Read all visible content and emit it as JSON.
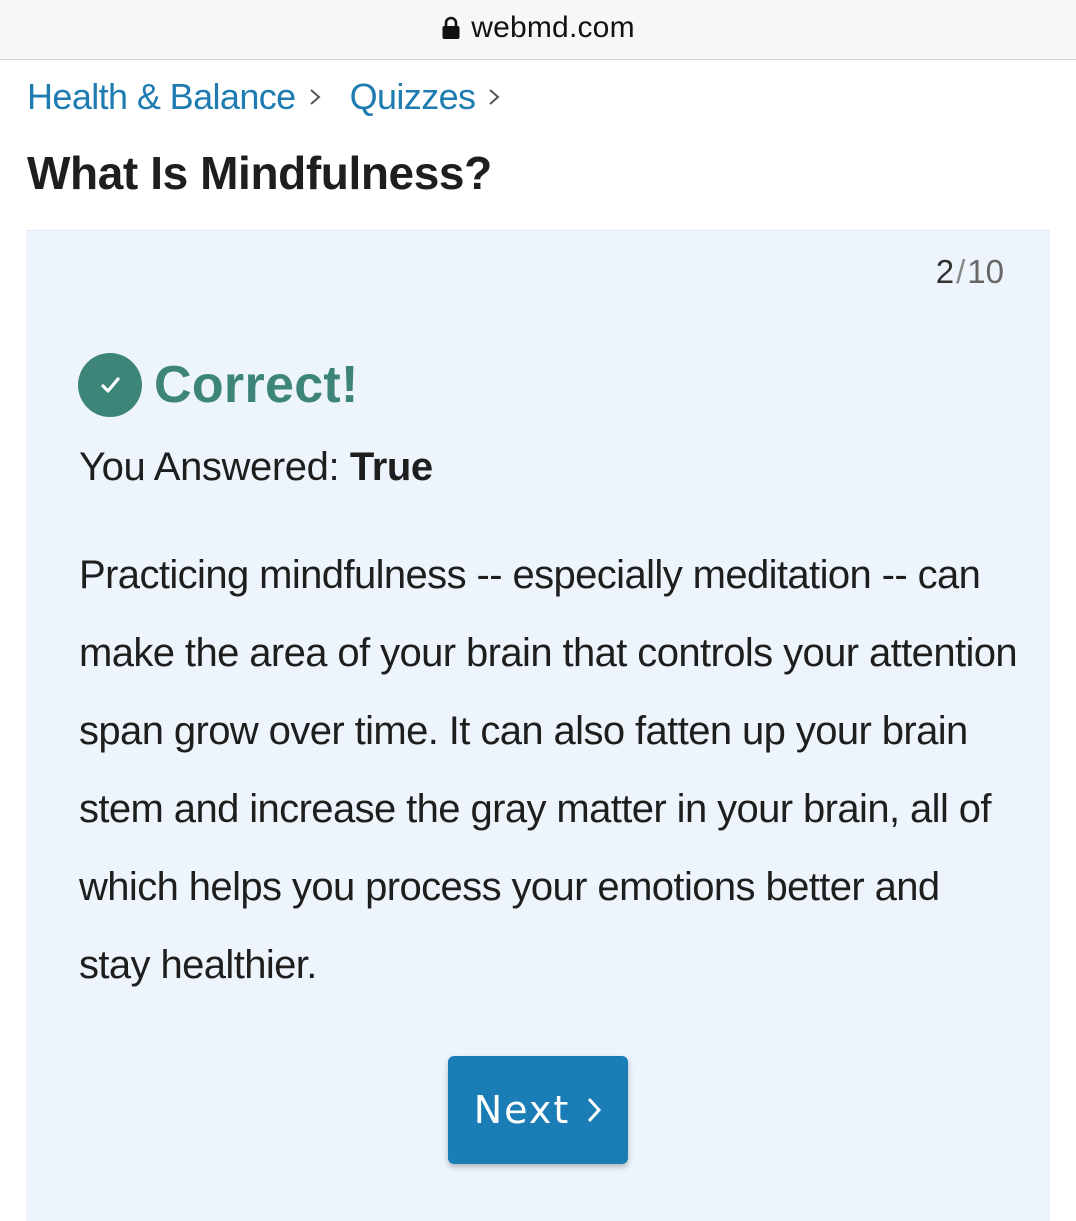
{
  "browser": {
    "url": "webmd.com",
    "lock_icon": "lock-icon"
  },
  "breadcrumb": {
    "items": [
      {
        "label": "Health & Balance"
      },
      {
        "label": "Quizzes"
      }
    ],
    "separator_icon": "chevron-right-icon"
  },
  "page": {
    "title": "What Is Mindfulness?"
  },
  "quiz": {
    "current": "2",
    "separator": "/",
    "total": "10",
    "result_icon": "check-circle-icon",
    "result_label": "Correct!",
    "answer_prefix": "You Answered: ",
    "answer_value": "True",
    "explanation": "Practicing mindfulness -- especially meditation -- can make the area of your brain that controls your attention span grow over time. It can also fatten up your brain stem and increase the gray matter in your brain, all of which helps you process your emotions better and stay healthier.",
    "next_label": "Next"
  },
  "colors": {
    "link": "#1f7cb1",
    "card_bg": "#edf4fc",
    "correct": "#3d8479",
    "button": "#1b7db5"
  }
}
